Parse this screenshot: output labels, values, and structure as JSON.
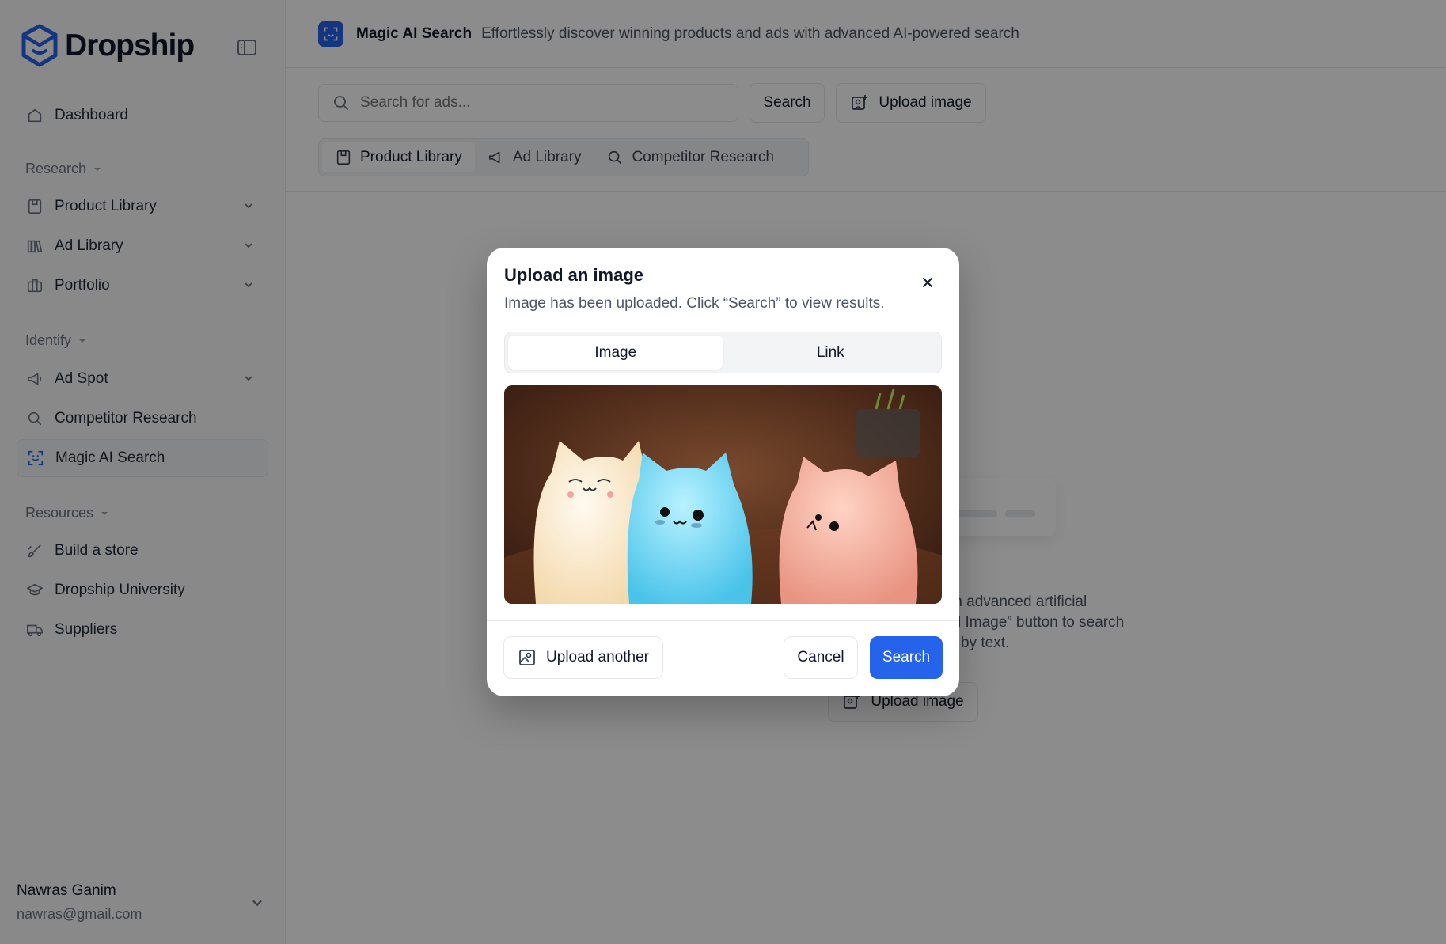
{
  "brand": {
    "name": "Dropship"
  },
  "sidebar": {
    "items_top": [
      {
        "label": "Dashboard",
        "icon": "home-icon"
      }
    ],
    "research": {
      "label": "Research",
      "items": [
        {
          "label": "Product Library",
          "icon": "book-icon"
        },
        {
          "label": "Ad Library",
          "icon": "library-icon"
        },
        {
          "label": "Portfolio",
          "icon": "briefcase-icon"
        }
      ]
    },
    "identify": {
      "label": "Identify",
      "items": [
        {
          "label": "Ad Spot",
          "icon": "megaphone-icon"
        },
        {
          "label": "Competitor Research",
          "icon": "search-icon"
        },
        {
          "label": "Magic AI Search",
          "icon": "scan-icon"
        }
      ]
    },
    "resources": {
      "label": "Resources",
      "items": [
        {
          "label": "Build a store",
          "icon": "brush-icon"
        },
        {
          "label": "Dropship University",
          "icon": "graduation-cap-icon"
        },
        {
          "label": "Suppliers",
          "icon": "truck-icon"
        }
      ]
    },
    "user": {
      "name": "Nawras Ganim",
      "email": "nawras@gmail.com"
    }
  },
  "header": {
    "title": "Magic AI Search",
    "description": "Effortlessly discover winning products and ads with advanced AI-powered search"
  },
  "search": {
    "placeholder": "Search for ads...",
    "value": "",
    "button_label": "Search",
    "upload_label": "Upload image"
  },
  "tabs": [
    {
      "label": "Product Library",
      "icon": "book-icon",
      "active": true
    },
    {
      "label": "Ad Library",
      "icon": "megaphone-icon",
      "active": false
    },
    {
      "label": "Competitor Research",
      "icon": "search-icon",
      "active": false
    }
  ],
  "empty_state": {
    "text_line1": "th advanced artificial",
    "text_line2": "l Image” button to search",
    "text_line3": "by text.",
    "upload_label": "Upload image"
  },
  "modal": {
    "title": "Upload an image",
    "description": "Image has been uploaded. Click “Search” to view results.",
    "segments": [
      {
        "label": "Image",
        "active": true
      },
      {
        "label": "Link",
        "active": false
      }
    ],
    "upload_another_label": "Upload another",
    "cancel_label": "Cancel",
    "search_label": "Search"
  },
  "colors": {
    "accent": "#2563eb",
    "overlay": "rgba(0,0,0,0.45)"
  }
}
